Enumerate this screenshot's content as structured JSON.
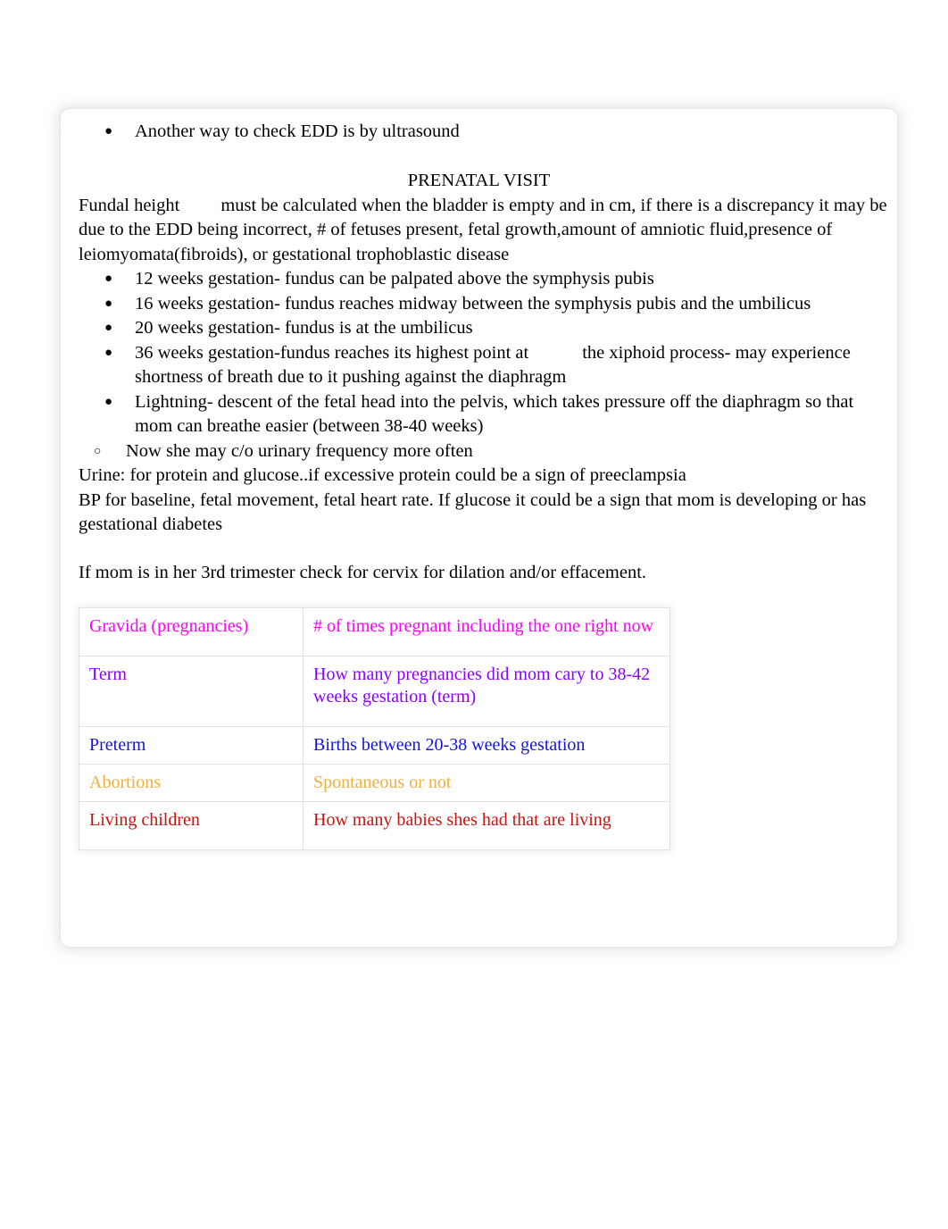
{
  "document": {
    "intro_bullet": "Another way to check EDD is by ultrasound",
    "section_heading": "PRENATAL VISIT",
    "fundal_label": "Fundal height",
    "fundal_text": "must be calculated when the bladder is empty and in cm, if there is a discrepancy it may be due to the EDD being incorrect, # of fetuses present, fetal growth,amount of amniotic fluid,presence of leiomyomata(fibroids), or gestational trophoblastic disease",
    "bullets": [
      {
        "text": "12 weeks gestation- fundus can be palpated above the symphysis pubis"
      },
      {
        "text": "16 weeks gestation- fundus reaches midway between the symphysis pubis and the umbilicus"
      },
      {
        "text": "20 weeks gestation- fundus is at the umbilicus"
      },
      {
        "text_a": "36 weeks gestation-fundus reaches its highest point at",
        "text_b": "the xiphoid process- may experience shortness of breath due to it pushing against the diaphragm"
      },
      {
        "text": "Lightning- descent of the fetal head into the pelvis, which takes pressure off the diaphragm so that mom can breathe easier (between 38-40 weeks)"
      }
    ],
    "sub_bullet": "Now she may c/o urinary frequency more often",
    "urine_line": "Urine:  for protein and glucose..if excessive protein could be a sign of preeclampsia",
    "bp_line": "BP for baseline, fetal movement, fetal heart rate. If glucose it could be a sign that mom is developing or has gestational diabetes",
    "trimester_line": "If mom is in her 3rd trimester check for cervix for dilation and/or effacement."
  },
  "gtpal_table": {
    "rows": [
      {
        "term": "Gravida (pregnancies)",
        "definition": "# of times pregnant including the one right now",
        "color": "#FF00FF"
      },
      {
        "term": "Term",
        "definition": "How many pregnancies did mom cary to 38-42 weeks gestation (term)",
        "color": "#8B00FF"
      },
      {
        "term": "Preterm",
        "definition": "Births between 20-38 weeks gestation",
        "color": "#1414E0"
      },
      {
        "term": "Abortions",
        "definition": "Spontaneous or not",
        "color": "#EFB040"
      },
      {
        "term": "Living children",
        "definition": "How many babies shes had that are living",
        "color": "#CC1111"
      }
    ]
  },
  "icons": {
    "bullet_disc": "●",
    "bullet_circle": "○"
  }
}
